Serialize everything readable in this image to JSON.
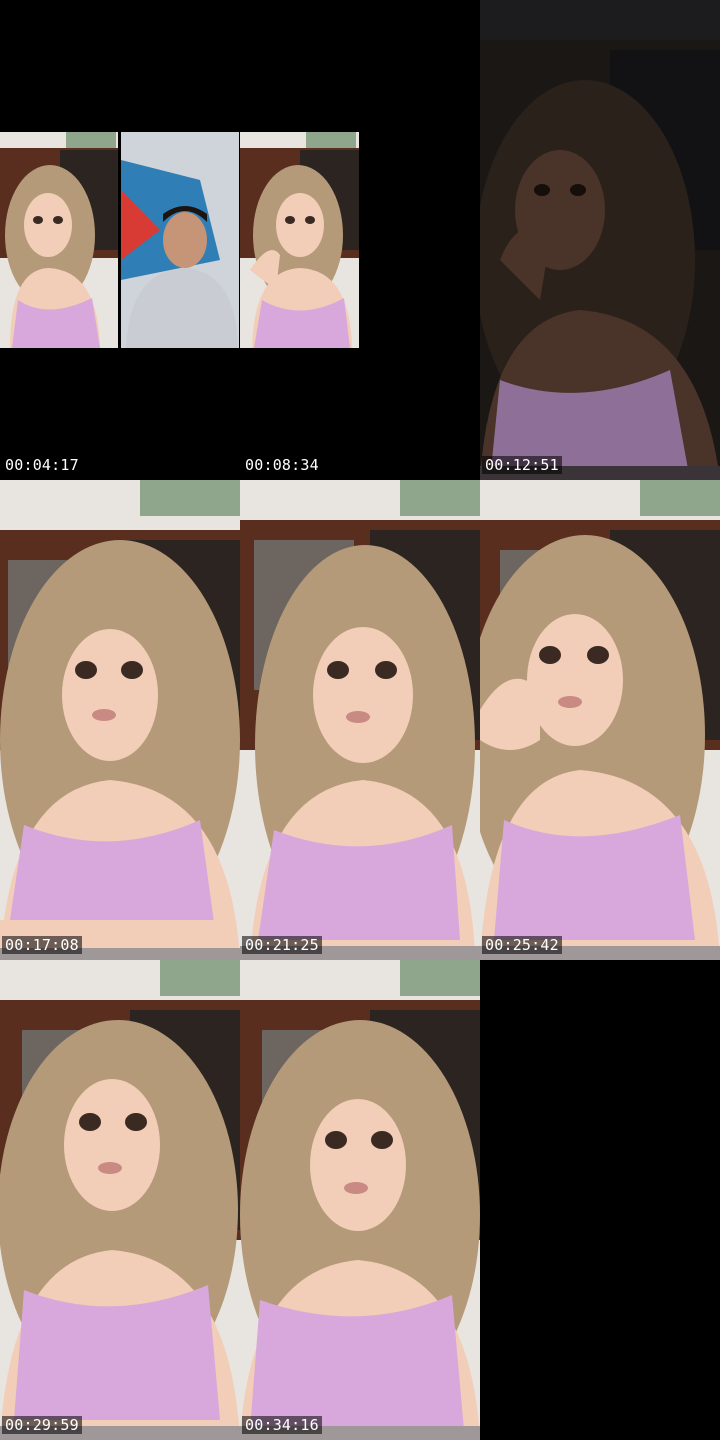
{
  "thumbnails": [
    {
      "timestamp": "00:04:17"
    },
    {
      "timestamp": "00:08:34"
    },
    {
      "timestamp": "00:12:51"
    },
    {
      "timestamp": "00:17:08"
    },
    {
      "timestamp": "00:21:25"
    },
    {
      "timestamp": "00:25:42"
    },
    {
      "timestamp": "00:29:59"
    },
    {
      "timestamp": "00:34:16"
    }
  ],
  "colors": {
    "wall": "#e8e4df",
    "cabinet": "#5a2e1f",
    "cabinet_dark": "#2c2420",
    "hair": "#b49a78",
    "skin": "#f2cdb8",
    "top": "#d8a8dc",
    "shirt_man": "#c9ccd2",
    "banner_blue": "#2f7fb6",
    "banner_red": "#d83a34"
  }
}
